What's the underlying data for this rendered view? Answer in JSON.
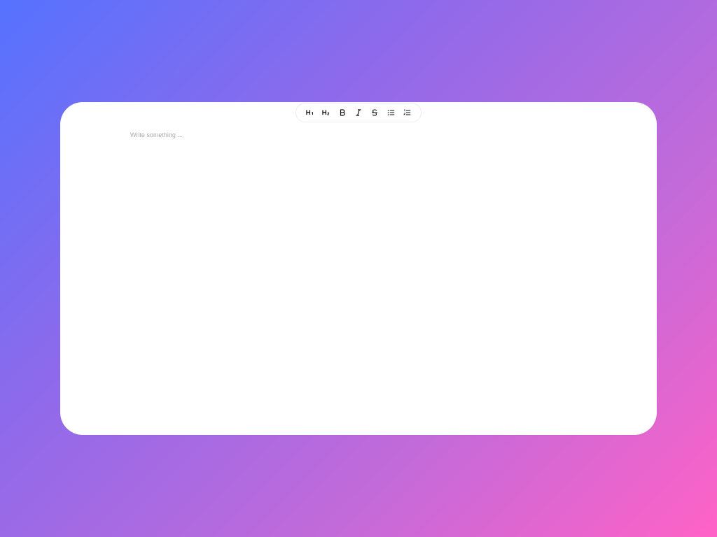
{
  "toolbar": {
    "buttons": [
      {
        "id": "heading-1",
        "icon": "heading-1-icon"
      },
      {
        "id": "heading-2",
        "icon": "heading-2-icon"
      },
      {
        "id": "bold",
        "icon": "bold-icon"
      },
      {
        "id": "italic",
        "icon": "italic-icon"
      },
      {
        "id": "strikethrough",
        "icon": "strikethrough-icon"
      },
      {
        "id": "bullet-list",
        "icon": "bullet-list-icon"
      },
      {
        "id": "ordered-list",
        "icon": "ordered-list-icon"
      }
    ]
  },
  "editor": {
    "placeholder": "Write something ..."
  },
  "colors": {
    "background_start": "#5572ff",
    "background_end": "#ff62c6",
    "card": "#ffffff",
    "placeholder": "#a9a9a9",
    "icon": "#111111"
  }
}
